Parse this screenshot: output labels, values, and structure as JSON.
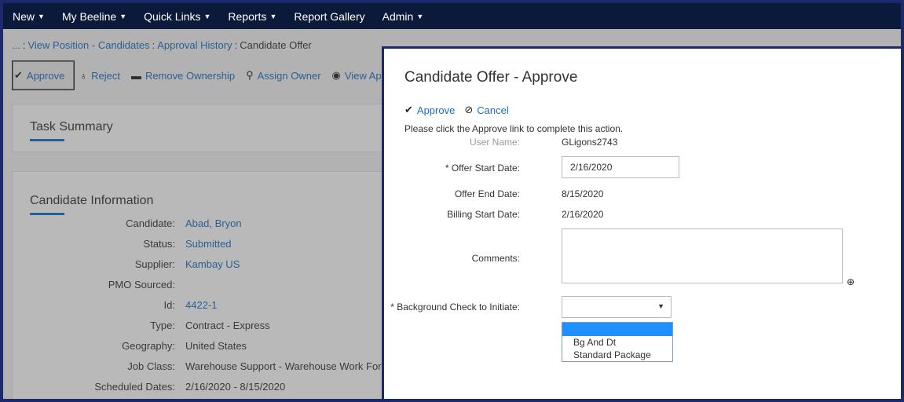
{
  "nav": {
    "items": [
      {
        "label": "New",
        "chevron": true
      },
      {
        "label": "My Beeline",
        "chevron": true
      },
      {
        "label": "Quick Links",
        "chevron": true
      },
      {
        "label": "Reports",
        "chevron": true
      },
      {
        "label": "Report Gallery",
        "chevron": false
      },
      {
        "label": "Admin",
        "chevron": true
      }
    ]
  },
  "breadcrumb": {
    "ellipsis": "...",
    "link1": "View Position - Candidates",
    "link2": "Approval History",
    "current": "Candidate Offer"
  },
  "toolbar": {
    "approve": "Approve",
    "reject": "Reject",
    "remove_ownership": "Remove Ownership",
    "assign_owner": "Assign Owner",
    "view_approvers": "View Approvers"
  },
  "task_summary": {
    "title": "Task Summary"
  },
  "candidate_info": {
    "title": "Candidate Information",
    "rows": [
      {
        "label": "Candidate:",
        "value": "Abad, Bryon",
        "link": true
      },
      {
        "label": "Status:",
        "value": "Submitted",
        "link": true
      },
      {
        "label": "Supplier:",
        "value": "Kambay US",
        "link": true
      },
      {
        "label": "PMO Sourced:",
        "value": "",
        "link": false
      },
      {
        "label": "Id:",
        "value": "4422-1",
        "link": true
      },
      {
        "label": "Type:",
        "value": "Contract - Express",
        "link": false
      },
      {
        "label": "Geography:",
        "value": "United States",
        "link": false
      },
      {
        "label": "Job Class:",
        "value": "Warehouse Support - Warehouse Work Forklift",
        "link": false
      },
      {
        "label": "Scheduled Dates:",
        "value": "2/16/2020 - 8/15/2020",
        "link": false
      }
    ]
  },
  "modal": {
    "title": "Candidate Offer - Approve",
    "approve_label": "Approve",
    "cancel_label": "Cancel",
    "hint": "Please click the Approve link to complete this action.",
    "user_name_label": "User Name:",
    "user_name_value": "GLigons2743",
    "offer_start_label": "* Offer Start Date:",
    "offer_start_value": "2/16/2020",
    "offer_end_label": "Offer End Date:",
    "offer_end_value": "8/15/2020",
    "billing_start_label": "Billing Start Date:",
    "billing_start_value": "2/16/2020",
    "comments_label": "Comments:",
    "comments_value": "",
    "bg_check_label": "* Background Check to Initiate:",
    "bg_check_selected": "",
    "bg_check_options": [
      "",
      "Bg And Dt",
      "Standard Package"
    ]
  },
  "colors": {
    "nav_bg": "#0b1a3a",
    "link": "#1b6ec2",
    "frame": "#1c2a6b",
    "highlight": "#1e90ff"
  }
}
